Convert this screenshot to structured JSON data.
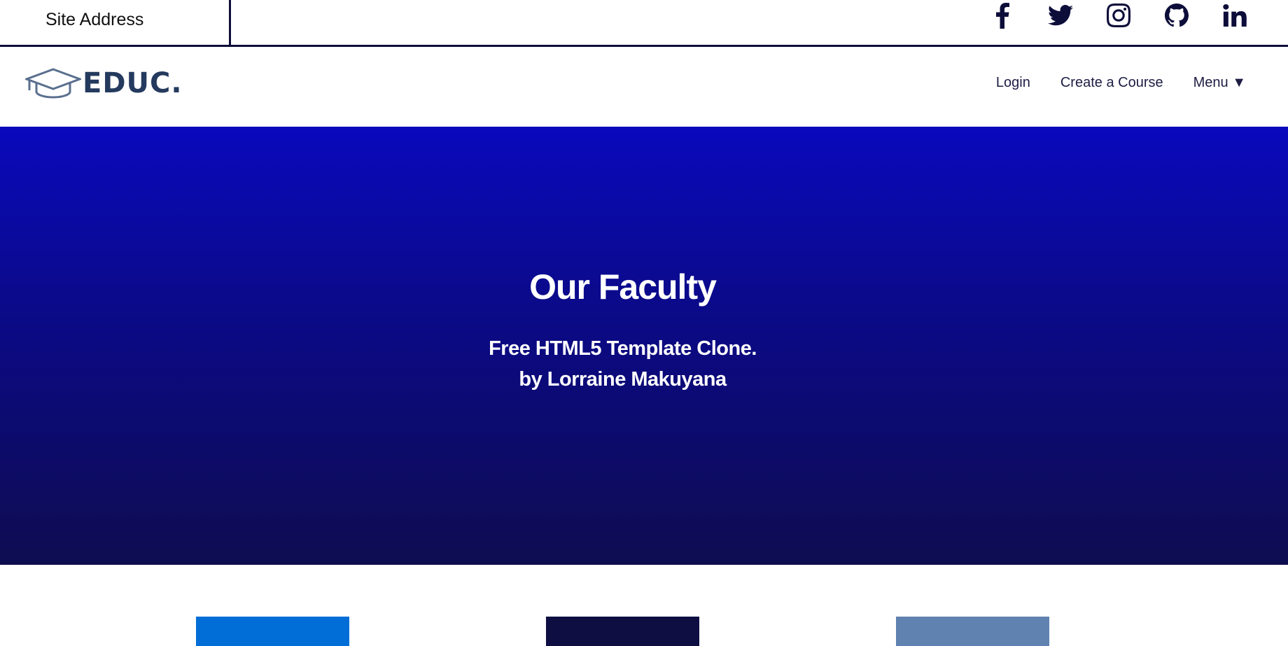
{
  "topbar": {
    "site_address": "Site Address",
    "socials": [
      {
        "icon": "facebook-icon"
      },
      {
        "icon": "twitter-icon"
      },
      {
        "icon": "instagram-icon"
      },
      {
        "icon": "github-icon"
      },
      {
        "icon": "linkedin-icon"
      }
    ]
  },
  "nav": {
    "logo_text": "EDUC.",
    "items": [
      {
        "label": "Login"
      },
      {
        "label": "Create a Course"
      },
      {
        "label": "Menu ▼"
      }
    ]
  },
  "hero": {
    "title": "Our Faculty",
    "subtitle_line1": "Free HTML5 Template Clone.",
    "subtitle_line2": "by Lorraine Makuyana"
  },
  "cards": {
    "colors": [
      "#006ed6",
      "#0e0e43",
      "#5f82b0"
    ]
  },
  "colors": {
    "brand": "#243a5e",
    "hero_top": "#0a09bd",
    "hero_bottom": "#0e0c50",
    "nav_text": "#1d1d44"
  }
}
